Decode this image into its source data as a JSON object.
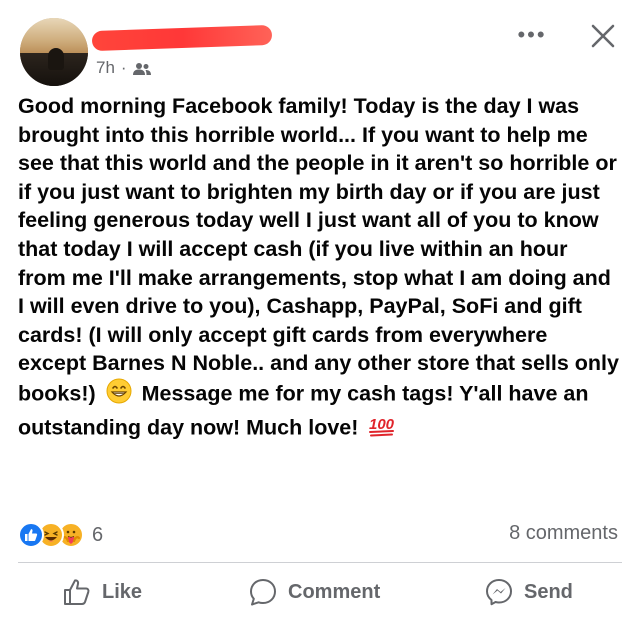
{
  "header": {
    "timestamp": "7h",
    "separator": "·",
    "audience_icon": "friends-icon",
    "more_label": "•••",
    "close_icon": "close-icon"
  },
  "post": {
    "text_part1": "Good morning Facebook family! Today is the day I was brought into this horrible world... If you want to help me see that this world and the people in it aren't so horrible or if you just want to brighten my birth day or if you are just feeling generous today well I just want all of you to know that today I will accept cash (if you live within an hour from me I'll make arrangements, stop what I am doing and I will even drive to you), Cashapp, PayPal, SoFi and gift cards! (I will only accept gift cards from everywhere except Barnes N Noble.. and any other store that sells only books!)",
    "emoji_grin": "😁",
    "text_part2": "Message me for my cash tags! Y'all have an outstanding day now! Much love!",
    "emoji_100": "💯"
  },
  "reactions": {
    "types": [
      "like",
      "haha",
      "care"
    ],
    "count": "6",
    "comments": "8 comments"
  },
  "actions": {
    "like": "Like",
    "comment": "Comment",
    "send": "Send"
  },
  "colors": {
    "text": "#050505",
    "secondary": "#65676b",
    "like_blue": "#1877f2",
    "haha_yellow": "#f7b125",
    "redaction": "#ff3b30"
  }
}
